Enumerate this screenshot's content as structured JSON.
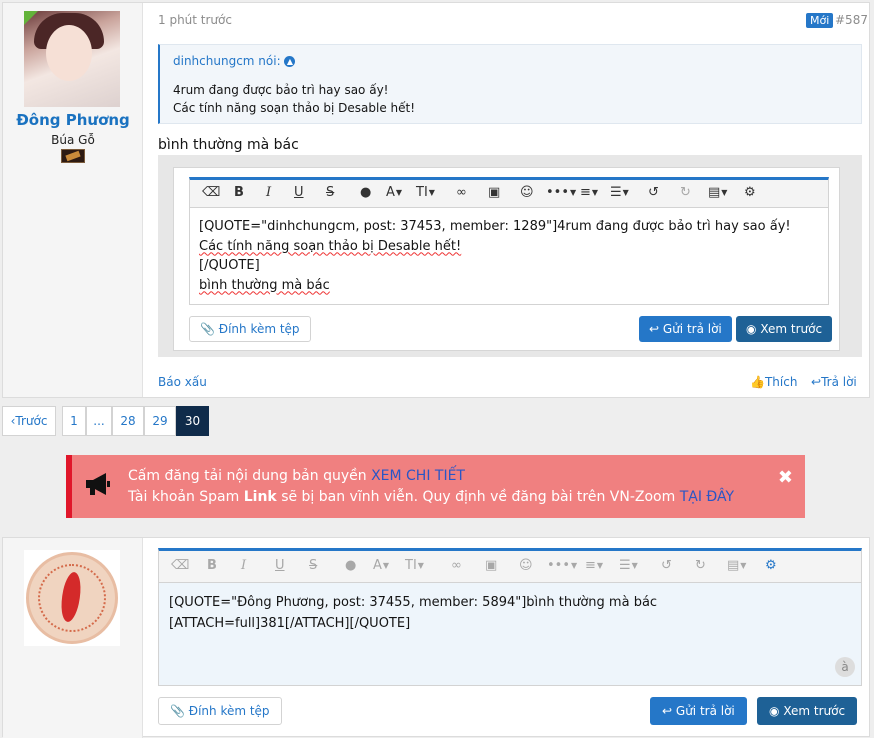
{
  "post": {
    "username": "Đông Phương",
    "user_title": "Búa Gỗ",
    "time": "1 phút trước",
    "new_badge": "Mới",
    "post_number": "#587",
    "quote": {
      "author": "dinhchungcm nói:",
      "line1": "4rum đang được bảo trì hay sao ấy!",
      "line2": "Các tính năng soạn thảo bị Desable hết!"
    },
    "message": "bình thường mà bác",
    "editor": {
      "line1": "[QUOTE=\"dinhchungcm, post: 37453, member: 1289\"]4rum đang được bảo trì hay sao ấy!",
      "line2": "Các tính năng soạn thảo bị Desable hết!",
      "line3": "[/QUOTE]",
      "line4": "bình thường mà bác"
    },
    "attach_label": "Đính kèm tệp",
    "send_label": "Gửi trả lời",
    "preview_label": "Xem trước",
    "report_label": "Báo xấu",
    "like_label": "Thích",
    "reply_label": "Trả lời"
  },
  "pagination": {
    "prev": "Trước",
    "pages": [
      "1",
      "...",
      "28",
      "29",
      "30"
    ],
    "active": "30"
  },
  "notice": {
    "line1_text": "Cấm đăng tải nội dung bản quyền",
    "line1_link": "XEM CHI TIẾT",
    "line2_text_a": "Tài khoản Spam",
    "line2_bold": "Link",
    "line2_text_b": "sẽ bị ban vĩnh viễn. Quy định về đăng bài trên VN-Zoom",
    "line2_link": "TẠI ĐÂY"
  },
  "reply_editor": {
    "line1": "[QUOTE=\"Đông Phương, post: 37455, member: 5894\"]bình thường mà bác",
    "line2": "[ATTACH=full]381[/ATTACH][/QUOTE]",
    "attach_label": "Đính kèm tệp",
    "send_label": "Gửi trả lời",
    "preview_label": "Xem trước"
  },
  "colors": {
    "accent": "#2577c8",
    "notice_bg": "#f08080",
    "notice_border": "#e0162a",
    "active_page": "#0f2b4a"
  }
}
